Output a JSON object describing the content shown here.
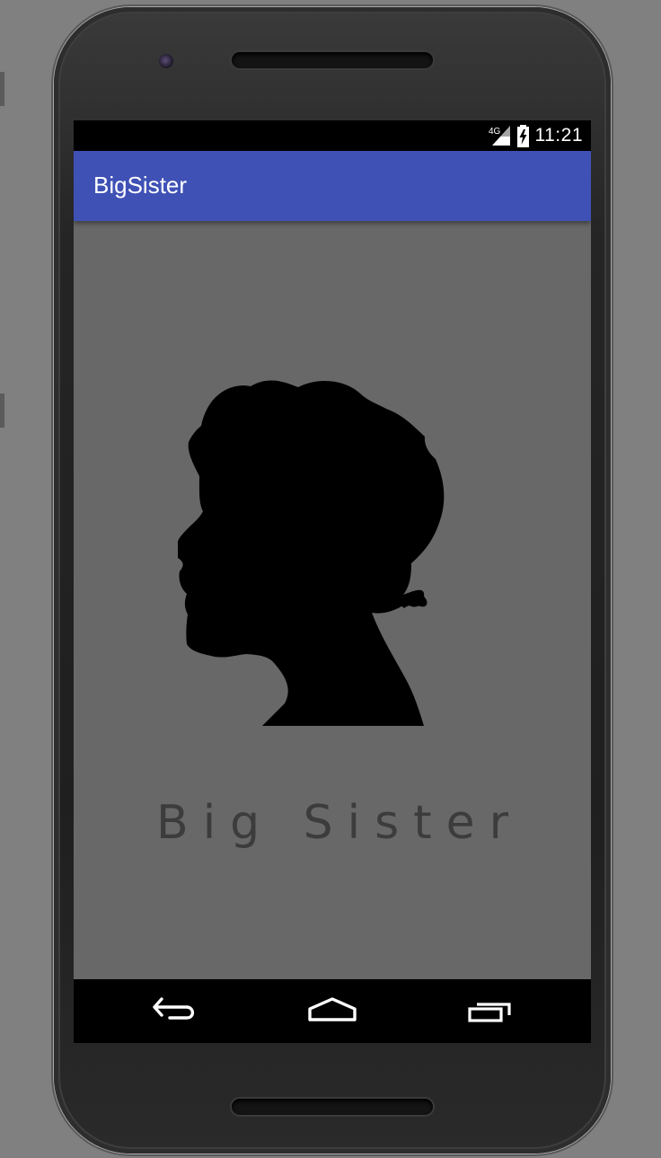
{
  "status_bar": {
    "network": "4G",
    "time": "11:21"
  },
  "app_bar": {
    "title": "BigSister"
  },
  "splash": {
    "brand_text": "Big Sister",
    "image": "woman-profile-silhouette"
  },
  "navigation": {
    "back_icon": "back-arrow-icon",
    "home_icon": "home-icon",
    "recents_icon": "recent-apps-icon"
  },
  "colors": {
    "app_bar": "#3f51b5",
    "screen_background": "#686868",
    "status_bar": "#000000",
    "navigation_bar": "#000000",
    "brand_text": "#3c3c3c"
  }
}
